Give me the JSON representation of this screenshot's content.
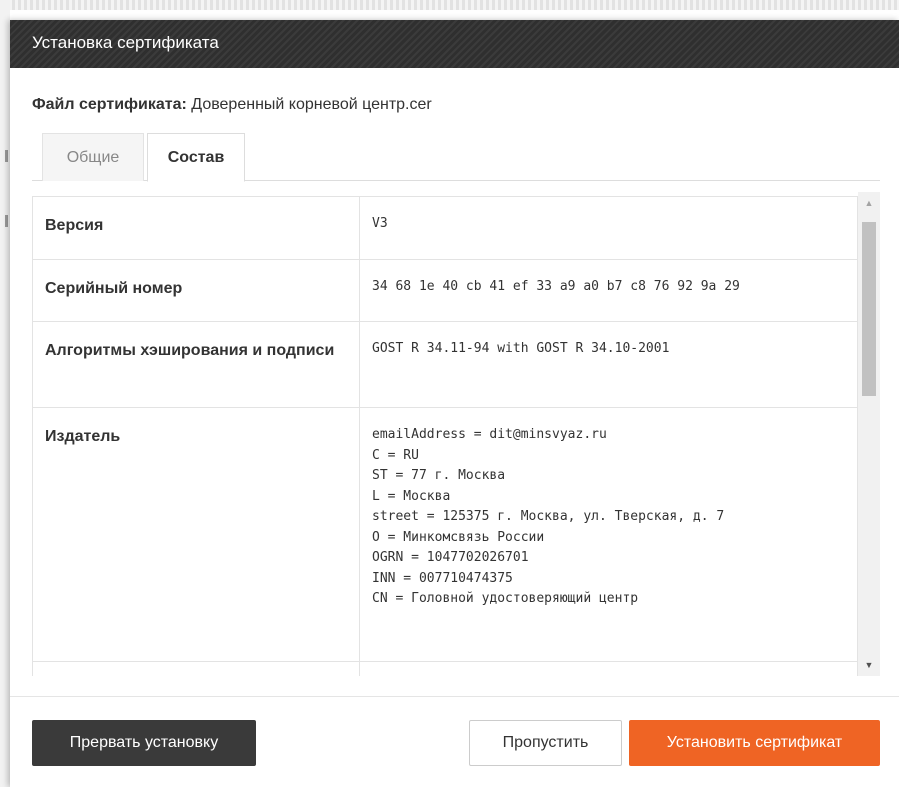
{
  "dialog": {
    "title": "Установка сертификата",
    "file_label": "Файл сертификата:",
    "file_name": "Доверенный корневой центр.cer"
  },
  "tabs": [
    {
      "label": "Общие",
      "active": false
    },
    {
      "label": "Состав",
      "active": true
    }
  ],
  "properties": [
    {
      "key": "Версия",
      "value": "V3"
    },
    {
      "key": "Серийный номер",
      "value": "34 68 1e 40 cb 41 ef 33 a9 a0 b7 c8 76 92 9a 29"
    },
    {
      "key": "Алгоритмы хэширования и подписи",
      "value": "GOST R 34.11-94 with GOST R 34.10-2001"
    },
    {
      "key": "Издатель",
      "value": "emailAddress = dit@minsvyaz.ru\nC = RU\nST = 77 г. Москва\nL = Москва\nstreet = 125375 г. Москва, ул. Тверская, д. 7\nO = Минкомсвязь России\nOGRN = 1047702026701\nINN = 007710474375\nCN = Головной удостоверяющий центр"
    }
  ],
  "buttons": {
    "abort": "Прервать установку",
    "skip": "Пропустить",
    "install": "Установить сертификат"
  },
  "colors": {
    "titlebar": "#2f2f2f",
    "primary_button": "#ef6424",
    "secondary_button": "#3a3a3a"
  },
  "icons": {
    "scroll_up": "triangle-up-icon",
    "scroll_down": "triangle-down-icon"
  }
}
